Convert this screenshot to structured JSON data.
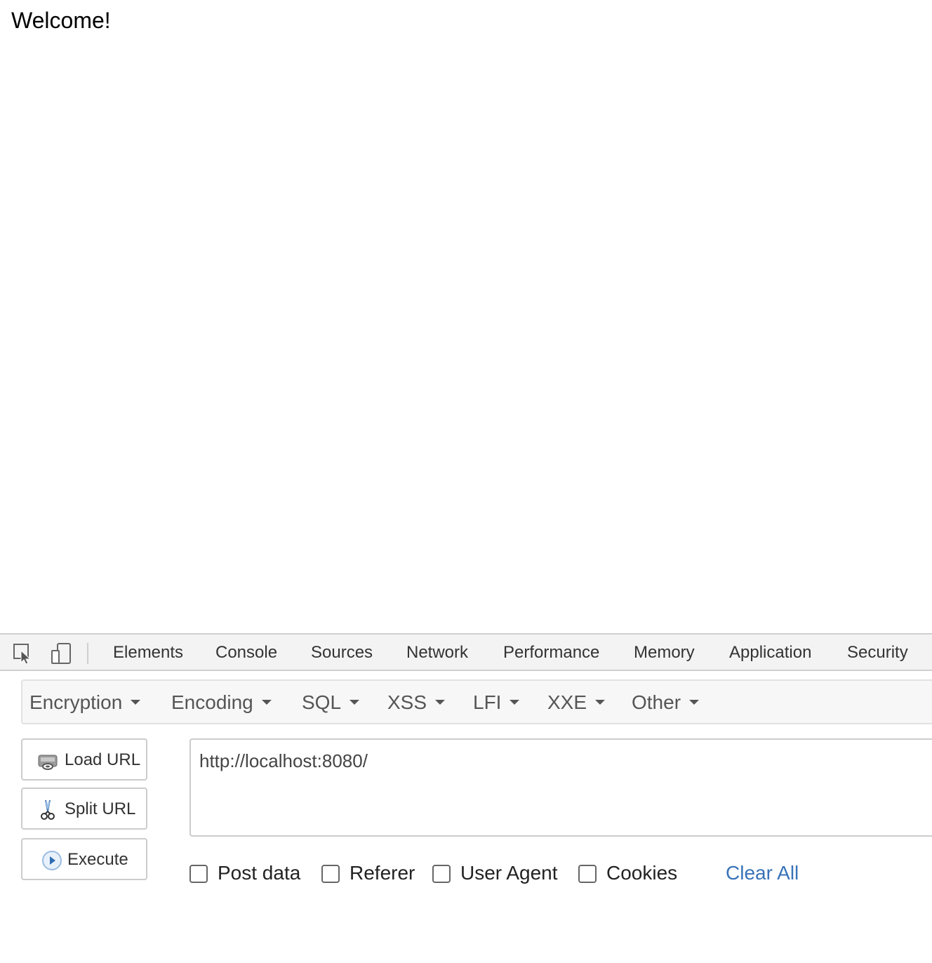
{
  "page": {
    "welcome_text": "Welcome!"
  },
  "devtools": {
    "tabs": [
      {
        "label": "Elements"
      },
      {
        "label": "Console"
      },
      {
        "label": "Sources"
      },
      {
        "label": "Network"
      },
      {
        "label": "Performance"
      },
      {
        "label": "Memory"
      },
      {
        "label": "Application"
      },
      {
        "label": "Security"
      }
    ],
    "icons": {
      "inspect": "inspect-element-icon",
      "device": "device-toolbar-icon"
    }
  },
  "hackbar": {
    "menu": [
      {
        "label": "Encryption"
      },
      {
        "label": "Encoding"
      },
      {
        "label": "SQL"
      },
      {
        "label": "XSS"
      },
      {
        "label": "LFI"
      },
      {
        "label": "XXE"
      },
      {
        "label": "Other"
      }
    ],
    "buttons": {
      "load_url": "Load URL",
      "split_url": "Split URL",
      "execute": "Execute"
    },
    "url_value": "http://localhost:8080/",
    "checkboxes": [
      {
        "label": "Post data",
        "checked": false
      },
      {
        "label": "Referer",
        "checked": false
      },
      {
        "label": "User Agent",
        "checked": false
      },
      {
        "label": "Cookies",
        "checked": false
      }
    ],
    "clear_all": "Clear All",
    "link_color": "#3973b8"
  }
}
